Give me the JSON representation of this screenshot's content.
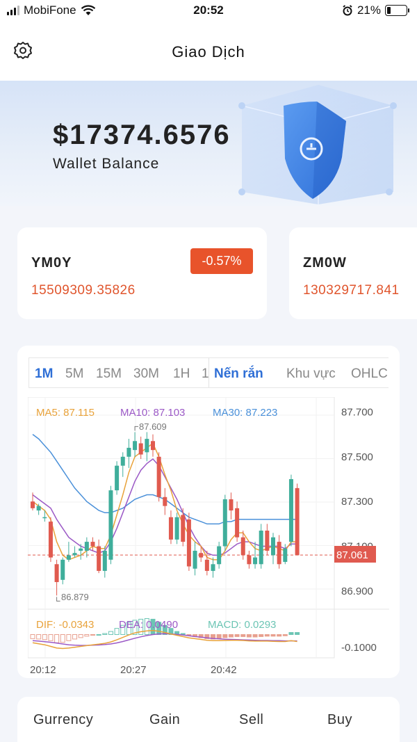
{
  "status_bar": {
    "carrier": "MobiFone",
    "time": "20:52",
    "battery": "21%",
    "battery_level": 0.21
  },
  "header": {
    "title": "Giao Dịch",
    "settings_icon": "gear-icon"
  },
  "banner": {
    "balance": "$17374.6576",
    "label": "Wallet Balance",
    "art_icon": "shield-icon"
  },
  "tickers": [
    {
      "symbol": "YM0Y",
      "price": "15509309.35826",
      "change": "-0.57%"
    },
    {
      "symbol": "ZM0W",
      "price": "130329717.841"
    }
  ],
  "chart": {
    "tabs": [
      "1M",
      "5M",
      "15M",
      "30M",
      "1H",
      "1"
    ],
    "style_tabs": [
      "Nến rắn",
      "Khu vực",
      "OHLC"
    ],
    "legend": {
      "ma5": "MA5: 87.115",
      "ma10": "MA10: 87.103",
      "ma30": "MA30: 87.223"
    },
    "macd_legend": {
      "dif": "DIF: -0.0343",
      "dea": "DEA: 0.0490",
      "macd": "MACD: 0.0293"
    },
    "high_label": "87.609",
    "low_label": "86.879",
    "current_label": "87.061",
    "macd_axis_label": "-0.1000",
    "colors": {
      "up": "#3fae9b",
      "down": "#e05a4f",
      "ma5": "#e8a23a",
      "ma10": "#9b59c6",
      "ma30": "#4a90d9"
    }
  },
  "chart_data": {
    "type": "candlestick",
    "y_ticks": [
      "87.700",
      "87.500",
      "87.300",
      "87.100",
      "86.900"
    ],
    "ylim": [
      86.85,
      87.72
    ],
    "x_ticks": [
      "20:12",
      "20:27",
      "20:42"
    ],
    "candles": [
      {
        "o": 87.3,
        "h": 87.34,
        "l": 87.26,
        "c": 87.27
      },
      {
        "o": 87.26,
        "h": 87.29,
        "l": 87.24,
        "c": 87.28
      },
      {
        "o": 87.23,
        "h": 87.26,
        "l": 87.21,
        "c": 87.23
      },
      {
        "o": 87.21,
        "h": 87.23,
        "l": 87.03,
        "c": 87.05
      },
      {
        "o": 87.02,
        "h": 87.04,
        "l": 86.88,
        "c": 86.94
      },
      {
        "o": 86.95,
        "h": 87.05,
        "l": 86.93,
        "c": 87.04
      },
      {
        "o": 87.04,
        "h": 87.12,
        "l": 87.03,
        "c": 87.06
      },
      {
        "o": 87.06,
        "h": 87.1,
        "l": 87.05,
        "c": 87.07
      },
      {
        "o": 87.08,
        "h": 87.11,
        "l": 87.04,
        "c": 87.09
      },
      {
        "o": 87.08,
        "h": 87.14,
        "l": 87.05,
        "c": 87.12
      },
      {
        "o": 87.12,
        "h": 87.14,
        "l": 87.08,
        "c": 87.1
      },
      {
        "o": 87.1,
        "h": 87.13,
        "l": 86.98,
        "c": 86.99
      },
      {
        "o": 86.99,
        "h": 87.1,
        "l": 86.96,
        "c": 87.08
      },
      {
        "o": 87.04,
        "h": 87.37,
        "l": 87.02,
        "c": 87.35
      },
      {
        "o": 87.35,
        "h": 87.48,
        "l": 87.33,
        "c": 87.46
      },
      {
        "o": 87.46,
        "h": 87.52,
        "l": 87.41,
        "c": 87.5
      },
      {
        "o": 87.5,
        "h": 87.58,
        "l": 87.45,
        "c": 87.54
      },
      {
        "o": 87.53,
        "h": 87.61,
        "l": 87.5,
        "c": 87.57
      },
      {
        "o": 87.56,
        "h": 87.59,
        "l": 87.49,
        "c": 87.51
      },
      {
        "o": 87.52,
        "h": 87.61,
        "l": 87.48,
        "c": 87.58
      },
      {
        "o": 87.57,
        "h": 87.6,
        "l": 87.5,
        "c": 87.53
      },
      {
        "o": 87.5,
        "h": 87.52,
        "l": 87.3,
        "c": 87.32
      },
      {
        "o": 87.32,
        "h": 87.36,
        "l": 87.24,
        "c": 87.28
      },
      {
        "o": 87.23,
        "h": 87.26,
        "l": 87.11,
        "c": 87.13
      },
      {
        "o": 87.13,
        "h": 87.25,
        "l": 87.11,
        "c": 87.23
      },
      {
        "o": 87.24,
        "h": 87.27,
        "l": 87.1,
        "c": 87.12
      },
      {
        "o": 87.22,
        "h": 87.25,
        "l": 86.99,
        "c": 87.01
      },
      {
        "o": 87.0,
        "h": 87.12,
        "l": 86.97,
        "c": 87.08
      },
      {
        "o": 87.07,
        "h": 87.1,
        "l": 87.03,
        "c": 87.05
      },
      {
        "o": 87.04,
        "h": 87.08,
        "l": 86.97,
        "c": 86.99
      },
      {
        "o": 86.99,
        "h": 87.05,
        "l": 86.96,
        "c": 87.02
      },
      {
        "o": 87.02,
        "h": 87.12,
        "l": 87.0,
        "c": 87.1
      },
      {
        "o": 87.1,
        "h": 87.33,
        "l": 87.08,
        "c": 87.31
      },
      {
        "o": 87.31,
        "h": 87.34,
        "l": 87.22,
        "c": 87.26
      },
      {
        "o": 87.27,
        "h": 87.3,
        "l": 87.12,
        "c": 87.14
      },
      {
        "o": 87.14,
        "h": 87.17,
        "l": 87.04,
        "c": 87.06
      },
      {
        "o": 87.06,
        "h": 87.08,
        "l": 87.0,
        "c": 87.02
      },
      {
        "o": 87.02,
        "h": 87.12,
        "l": 87.0,
        "c": 87.05
      },
      {
        "o": 87.02,
        "h": 87.2,
        "l": 87.0,
        "c": 87.17
      },
      {
        "o": 87.17,
        "h": 87.2,
        "l": 87.06,
        "c": 87.08
      },
      {
        "o": 87.06,
        "h": 87.16,
        "l": 87.02,
        "c": 87.14
      },
      {
        "o": 87.12,
        "h": 87.15,
        "l": 87.0,
        "c": 87.02
      },
      {
        "o": 87.03,
        "h": 87.11,
        "l": 87.02,
        "c": 87.09
      },
      {
        "o": 87.12,
        "h": 87.42,
        "l": 87.1,
        "c": 87.4
      },
      {
        "o": 87.36,
        "h": 87.38,
        "l": 87.06,
        "c": 87.06
      }
    ],
    "ma5": [
      87.3,
      87.28,
      87.26,
      87.22,
      87.12,
      87.06,
      87.04,
      87.05,
      87.06,
      87.08,
      87.1,
      87.09,
      87.09,
      87.15,
      87.24,
      87.33,
      87.43,
      87.5,
      87.52,
      87.54,
      87.56,
      87.5,
      87.42,
      87.35,
      87.26,
      87.2,
      87.15,
      87.12,
      87.1,
      87.05,
      87.04,
      87.04,
      87.08,
      87.13,
      87.16,
      87.16,
      87.12,
      87.09,
      87.08,
      87.09,
      87.1,
      87.09,
      87.08,
      87.12,
      87.12
    ],
    "ma10": [
      87.33,
      87.31,
      87.29,
      87.27,
      87.22,
      87.18,
      87.14,
      87.12,
      87.1,
      87.09,
      87.08,
      87.07,
      87.08,
      87.12,
      87.18,
      87.25,
      87.32,
      87.39,
      87.44,
      87.47,
      87.49,
      87.46,
      87.41,
      87.36,
      87.31,
      87.25,
      87.19,
      87.14,
      87.1,
      87.07,
      87.06,
      87.06,
      87.07,
      87.09,
      87.11,
      87.12,
      87.12,
      87.11,
      87.1,
      87.1,
      87.1,
      87.1,
      87.09,
      87.11,
      87.11
    ],
    "ma30": [
      87.6,
      87.58,
      87.55,
      87.52,
      87.48,
      87.44,
      87.4,
      87.36,
      87.33,
      87.3,
      87.28,
      87.26,
      87.25,
      87.25,
      87.26,
      87.27,
      87.29,
      87.31,
      87.32,
      87.33,
      87.33,
      87.32,
      87.31,
      87.29,
      87.27,
      87.25,
      87.23,
      87.22,
      87.21,
      87.2,
      87.2,
      87.2,
      87.21,
      87.21,
      87.22,
      87.22,
      87.22,
      87.22,
      87.22,
      87.22,
      87.22,
      87.22,
      87.22,
      87.22,
      87.22
    ],
    "macd_hist": [
      -0.02,
      -0.022,
      -0.025,
      -0.03,
      -0.04,
      -0.038,
      -0.03,
      -0.022,
      -0.015,
      -0.008,
      -0.002,
      0.0,
      0.005,
      0.015,
      0.03,
      0.045,
      0.06,
      0.07,
      0.075,
      0.078,
      0.075,
      0.06,
      0.045,
      0.03,
      0.015,
      0.005,
      -0.005,
      -0.01,
      -0.015,
      -0.02,
      -0.022,
      -0.02,
      -0.015,
      -0.012,
      -0.01,
      -0.01,
      -0.012,
      -0.012,
      -0.01,
      -0.008,
      -0.008,
      -0.008,
      -0.006,
      0.01,
      0.01
    ],
    "dif": [
      -0.04,
      -0.045,
      -0.05,
      -0.058,
      -0.066,
      -0.068,
      -0.066,
      -0.062,
      -0.058,
      -0.054,
      -0.05,
      -0.047,
      -0.043,
      -0.036,
      -0.026,
      -0.014,
      -0.002,
      0.008,
      0.014,
      0.018,
      0.02,
      0.016,
      0.01,
      0.003,
      -0.004,
      -0.01,
      -0.016,
      -0.02,
      -0.024,
      -0.028,
      -0.03,
      -0.03,
      -0.029,
      -0.028,
      -0.028,
      -0.029,
      -0.031,
      -0.032,
      -0.032,
      -0.032,
      -0.033,
      -0.034,
      -0.034,
      -0.03,
      -0.034
    ],
    "dea": [
      -0.03,
      -0.032,
      -0.035,
      -0.038,
      -0.042,
      -0.046,
      -0.05,
      -0.052,
      -0.053,
      -0.053,
      -0.052,
      -0.051,
      -0.049,
      -0.046,
      -0.041,
      -0.034,
      -0.026,
      -0.018,
      -0.011,
      -0.005,
      0.0,
      0.003,
      0.004,
      0.003,
      0.001,
      -0.002,
      -0.006,
      -0.01,
      -0.013,
      -0.016,
      -0.019,
      -0.021,
      -0.023,
      -0.024,
      -0.025,
      -0.026,
      -0.027,
      -0.028,
      -0.029,
      -0.029,
      -0.03,
      -0.03,
      -0.031,
      -0.031,
      -0.031
    ]
  },
  "table": {
    "headers": [
      "Gurrency",
      "Gain",
      "Sell",
      "Buy"
    ]
  }
}
